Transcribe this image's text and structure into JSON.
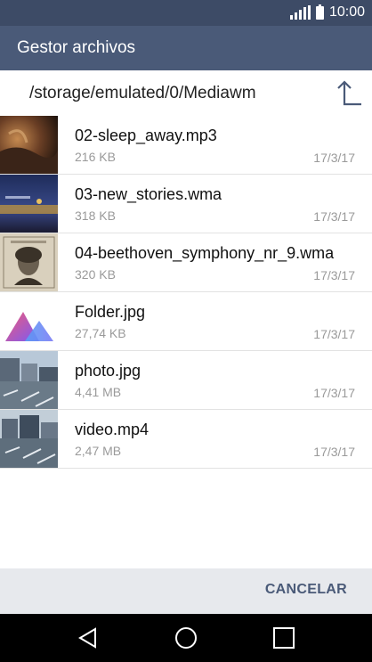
{
  "status_bar": {
    "time": "10:00"
  },
  "app_bar": {
    "title": "Gestor archivos"
  },
  "path": {
    "current": "/storage/emulated/0/Mediawm"
  },
  "files": [
    {
      "name": "02-sleep_away.mp3",
      "size": "216 KB",
      "date": "17/3/17",
      "thumb": "album-art-sleep-away"
    },
    {
      "name": "03-new_stories.wma",
      "size": "318 KB",
      "date": "17/3/17",
      "thumb": "album-art-new-stories"
    },
    {
      "name": "04-beethoven_symphony_nr_9.wma",
      "size": "320 KB",
      "date": "17/3/17",
      "thumb": "album-art-beethoven"
    },
    {
      "name": "Folder.jpg",
      "size": "27,74 KB",
      "date": "17/3/17",
      "thumb": "folder-image-icon"
    },
    {
      "name": "photo.jpg",
      "size": "4,41 MB",
      "date": "17/3/17",
      "thumb": "harbor-photo"
    },
    {
      "name": "video.mp4",
      "size": "2,47 MB",
      "date": "17/3/17",
      "thumb": "harbor-video"
    }
  ],
  "actions": {
    "cancel": "CANCELAR"
  },
  "colors": {
    "status_bar": "#3d4b66",
    "app_bar": "#4a5a78",
    "accent": "#4a5a78",
    "bottom_bar": "#e7e9ed"
  }
}
